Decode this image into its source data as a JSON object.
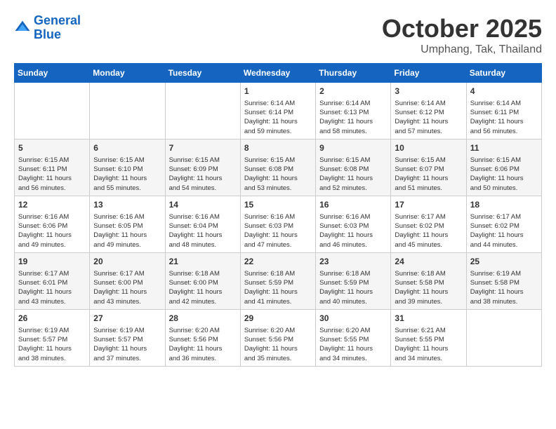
{
  "header": {
    "logo_line1": "General",
    "logo_line2": "Blue",
    "month": "October 2025",
    "location": "Umphang, Tak, Thailand"
  },
  "days_of_week": [
    "Sunday",
    "Monday",
    "Tuesday",
    "Wednesday",
    "Thursday",
    "Friday",
    "Saturday"
  ],
  "weeks": [
    [
      {
        "day": "",
        "info": ""
      },
      {
        "day": "",
        "info": ""
      },
      {
        "day": "",
        "info": ""
      },
      {
        "day": "1",
        "info": "Sunrise: 6:14 AM\nSunset: 6:14 PM\nDaylight: 11 hours\nand 59 minutes."
      },
      {
        "day": "2",
        "info": "Sunrise: 6:14 AM\nSunset: 6:13 PM\nDaylight: 11 hours\nand 58 minutes."
      },
      {
        "day": "3",
        "info": "Sunrise: 6:14 AM\nSunset: 6:12 PM\nDaylight: 11 hours\nand 57 minutes."
      },
      {
        "day": "4",
        "info": "Sunrise: 6:14 AM\nSunset: 6:11 PM\nDaylight: 11 hours\nand 56 minutes."
      }
    ],
    [
      {
        "day": "5",
        "info": "Sunrise: 6:15 AM\nSunset: 6:11 PM\nDaylight: 11 hours\nand 56 minutes."
      },
      {
        "day": "6",
        "info": "Sunrise: 6:15 AM\nSunset: 6:10 PM\nDaylight: 11 hours\nand 55 minutes."
      },
      {
        "day": "7",
        "info": "Sunrise: 6:15 AM\nSunset: 6:09 PM\nDaylight: 11 hours\nand 54 minutes."
      },
      {
        "day": "8",
        "info": "Sunrise: 6:15 AM\nSunset: 6:08 PM\nDaylight: 11 hours\nand 53 minutes."
      },
      {
        "day": "9",
        "info": "Sunrise: 6:15 AM\nSunset: 6:08 PM\nDaylight: 11 hours\nand 52 minutes."
      },
      {
        "day": "10",
        "info": "Sunrise: 6:15 AM\nSunset: 6:07 PM\nDaylight: 11 hours\nand 51 minutes."
      },
      {
        "day": "11",
        "info": "Sunrise: 6:15 AM\nSunset: 6:06 PM\nDaylight: 11 hours\nand 50 minutes."
      }
    ],
    [
      {
        "day": "12",
        "info": "Sunrise: 6:16 AM\nSunset: 6:06 PM\nDaylight: 11 hours\nand 49 minutes."
      },
      {
        "day": "13",
        "info": "Sunrise: 6:16 AM\nSunset: 6:05 PM\nDaylight: 11 hours\nand 49 minutes."
      },
      {
        "day": "14",
        "info": "Sunrise: 6:16 AM\nSunset: 6:04 PM\nDaylight: 11 hours\nand 48 minutes."
      },
      {
        "day": "15",
        "info": "Sunrise: 6:16 AM\nSunset: 6:03 PM\nDaylight: 11 hours\nand 47 minutes."
      },
      {
        "day": "16",
        "info": "Sunrise: 6:16 AM\nSunset: 6:03 PM\nDaylight: 11 hours\nand 46 minutes."
      },
      {
        "day": "17",
        "info": "Sunrise: 6:17 AM\nSunset: 6:02 PM\nDaylight: 11 hours\nand 45 minutes."
      },
      {
        "day": "18",
        "info": "Sunrise: 6:17 AM\nSunset: 6:02 PM\nDaylight: 11 hours\nand 44 minutes."
      }
    ],
    [
      {
        "day": "19",
        "info": "Sunrise: 6:17 AM\nSunset: 6:01 PM\nDaylight: 11 hours\nand 43 minutes."
      },
      {
        "day": "20",
        "info": "Sunrise: 6:17 AM\nSunset: 6:00 PM\nDaylight: 11 hours\nand 43 minutes."
      },
      {
        "day": "21",
        "info": "Sunrise: 6:18 AM\nSunset: 6:00 PM\nDaylight: 11 hours\nand 42 minutes."
      },
      {
        "day": "22",
        "info": "Sunrise: 6:18 AM\nSunset: 5:59 PM\nDaylight: 11 hours\nand 41 minutes."
      },
      {
        "day": "23",
        "info": "Sunrise: 6:18 AM\nSunset: 5:59 PM\nDaylight: 11 hours\nand 40 minutes."
      },
      {
        "day": "24",
        "info": "Sunrise: 6:18 AM\nSunset: 5:58 PM\nDaylight: 11 hours\nand 39 minutes."
      },
      {
        "day": "25",
        "info": "Sunrise: 6:19 AM\nSunset: 5:58 PM\nDaylight: 11 hours\nand 38 minutes."
      }
    ],
    [
      {
        "day": "26",
        "info": "Sunrise: 6:19 AM\nSunset: 5:57 PM\nDaylight: 11 hours\nand 38 minutes."
      },
      {
        "day": "27",
        "info": "Sunrise: 6:19 AM\nSunset: 5:57 PM\nDaylight: 11 hours\nand 37 minutes."
      },
      {
        "day": "28",
        "info": "Sunrise: 6:20 AM\nSunset: 5:56 PM\nDaylight: 11 hours\nand 36 minutes."
      },
      {
        "day": "29",
        "info": "Sunrise: 6:20 AM\nSunset: 5:56 PM\nDaylight: 11 hours\nand 35 minutes."
      },
      {
        "day": "30",
        "info": "Sunrise: 6:20 AM\nSunset: 5:55 PM\nDaylight: 11 hours\nand 34 minutes."
      },
      {
        "day": "31",
        "info": "Sunrise: 6:21 AM\nSunset: 5:55 PM\nDaylight: 11 hours\nand 34 minutes."
      },
      {
        "day": "",
        "info": ""
      }
    ]
  ]
}
